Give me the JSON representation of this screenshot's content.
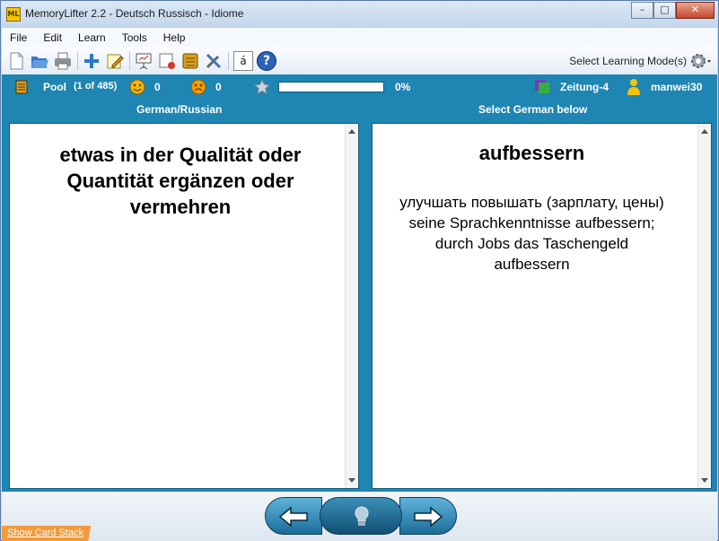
{
  "window": {
    "title": "MemoryLifter 2.2 - Deutsch Russisch - Idiome",
    "app_icon_text": "ML",
    "minimize": "–",
    "maximize": "□",
    "close": "✕"
  },
  "menu": [
    "File",
    "Edit",
    "Learn",
    "Tools",
    "Help"
  ],
  "toolbar": {
    "learning_mode_label": "Select Learning Mode(s)",
    "icons": [
      "new-file-icon",
      "open-folder-icon",
      "print-icon",
      "add-card-icon",
      "edit-card-icon",
      "presentation-icon",
      "print-cards-icon",
      "card-stack-icon",
      "tools-icon",
      "special-char-icon",
      "help-icon",
      "gear-icon"
    ],
    "special_char": "á",
    "help_char": "?"
  },
  "status": {
    "pool_label": "Pool",
    "pool_count": "(1 of 485)",
    "correct_count": "0",
    "wrong_count": "0",
    "progress_percent": "0%",
    "progress_value": 0,
    "box_name": "Zeitung-4",
    "user_name": "manwei30"
  },
  "columns": {
    "left_header": "German/Russian",
    "right_header": "Select German below"
  },
  "question": {
    "text": "etwas in der Qualität oder Quantität ergänzen oder vermehren"
  },
  "answer": {
    "title": "aufbessern",
    "lines": [
      "улучшать повышать (зарплату, цены)",
      "seine Sprachkenntnisse aufbessern;",
      "durch Jobs das Taschengeld",
      "aufbessern"
    ]
  },
  "bottom": {
    "show_card_stack": "Show Card Stack"
  },
  "colors": {
    "accent": "#1f85b2",
    "stack_tab": "#f39a3a"
  }
}
